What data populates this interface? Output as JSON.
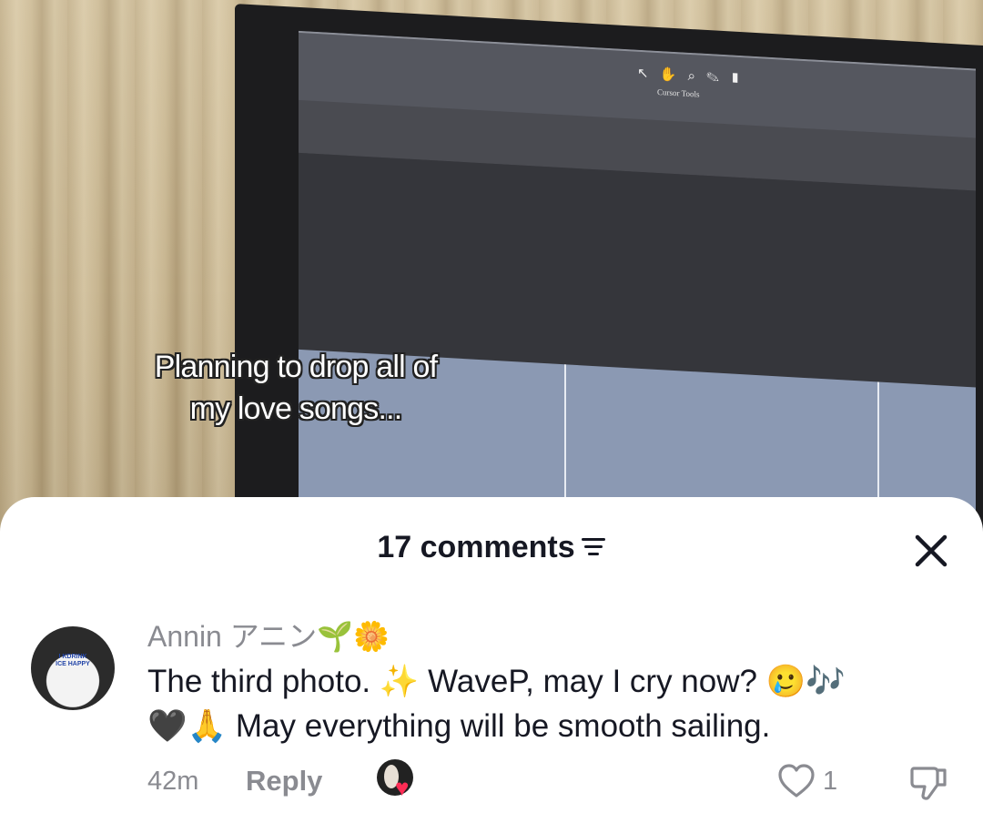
{
  "video": {
    "caption_line1": "Planning to drop all of",
    "caption_line2": "my love songs...",
    "screen_toolbar_label": "Cursor Tools"
  },
  "comments_panel": {
    "count_label": "17 comments",
    "filter_icon": "filter-icon",
    "close_icon": "close-icon"
  },
  "comment": {
    "username": "Annin アニン🌱🌼",
    "avatar_shirt_text": "I KDRINK ICE HAPPY",
    "text_line1": "The third photo. ✨ WaveP, may I cry now? 🥲🎶",
    "text_line2": "🖤🙏 May everything will be smooth sailing.",
    "time": "42m",
    "reply_label": "Reply",
    "likes": "1"
  },
  "colors": {
    "primary_text": "#161823",
    "secondary_text": "#8a8b91",
    "heart_accent": "#fe2c55",
    "sheet_bg": "#ffffff"
  }
}
